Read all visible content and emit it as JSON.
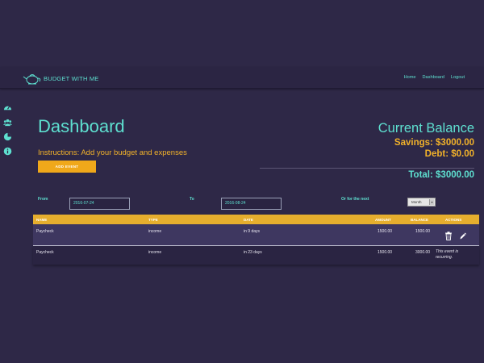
{
  "nav": {
    "brand": "BUDGET WITH ME",
    "links": [
      "Home",
      "Dashboard",
      "Logout"
    ],
    "logo_icon": "teapot-icon"
  },
  "sidebar": {
    "icons": [
      "gauge-icon",
      "users-icon",
      "pie-chart-icon",
      "info-icon"
    ]
  },
  "main": {
    "title": "Dashboard",
    "instructions": "Instructions: Add your budget and expenses",
    "add_button": "ADD EVENT"
  },
  "balance": {
    "title": "Current Balance",
    "savings": "Savings: $3000.00",
    "debt": "Debt: $0.00",
    "total": "Total: $3000.00"
  },
  "filters": {
    "from_label": "From",
    "from_value": "2016-07-24",
    "to_label": "To",
    "to_value": "2016-08-24",
    "next_label": "Or for the next",
    "period": "Month"
  },
  "table": {
    "headers": [
      "NAME",
      "TYPE",
      "DATE",
      "AMOUNT",
      "BALANCE",
      "ACTIONS"
    ],
    "rows": [
      {
        "name": "Paycheck",
        "type": "income",
        "date": "in 9 days",
        "amount": "1500.00",
        "balance": "1500.00",
        "actions": ""
      },
      {
        "name": "Paycheck",
        "type": "income",
        "date": "in 23 days",
        "amount": "1500.00",
        "balance": "3000.00",
        "actions": "This event is recurring."
      }
    ]
  },
  "colors": {
    "background": "#2e2847",
    "accent": "#5ee0d0",
    "gold": "#f0a81a"
  }
}
